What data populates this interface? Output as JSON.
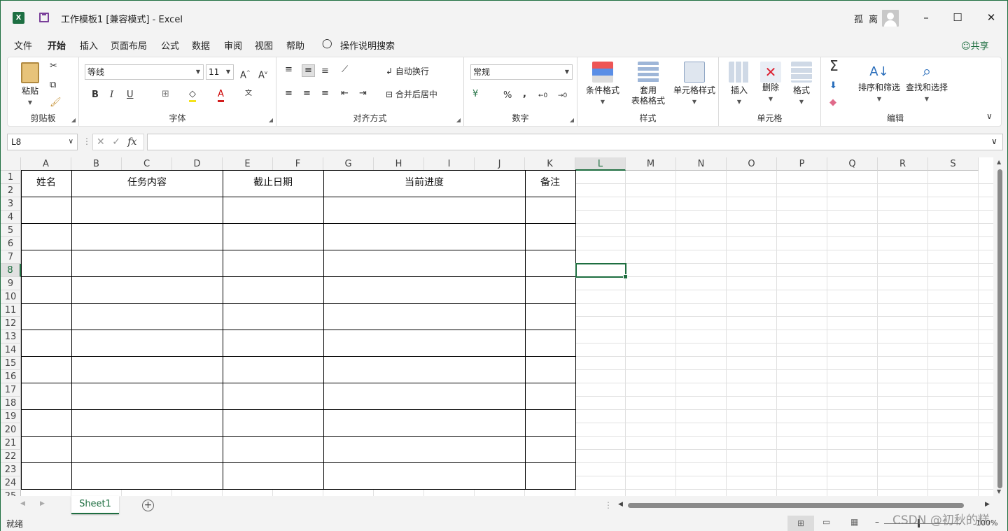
{
  "title_bar": {
    "title": "工作模板1  [兼容模式]  -  Excel",
    "username": "孤 离",
    "minimize": "–",
    "maximize": "☐",
    "close": "✕"
  },
  "menu": {
    "tabs": [
      "文件",
      "开始",
      "插入",
      "页面布局",
      "公式",
      "数据",
      "审阅",
      "视图",
      "帮助",
      "操作说明搜索"
    ],
    "active_tab": "开始",
    "share": "共享"
  },
  "ribbon": {
    "clipboard": {
      "label": "剪贴板",
      "paste": "粘贴"
    },
    "font": {
      "label": "字体",
      "font_name": "等线",
      "font_size": "11"
    },
    "alignment": {
      "label": "对齐方式",
      "wrap": "自动换行",
      "merge": "合并后居中"
    },
    "number": {
      "label": "数字",
      "format": "常规",
      "percent": "%",
      "comma": ","
    },
    "styles": {
      "label": "样式",
      "conditional": "条件格式",
      "table_1": "套用",
      "table_2": "表格格式",
      "cell_styles": "单元格样式"
    },
    "cells": {
      "label": "单元格",
      "insert": "插入",
      "delete": "删除",
      "format": "格式"
    },
    "editing": {
      "label": "编辑",
      "sort_filter": "排序和筛选",
      "find_select": "查找和选择"
    }
  },
  "formula_bar": {
    "name_box": "L8",
    "fx": "fx",
    "formula": ""
  },
  "grid": {
    "columns": [
      "A",
      "B",
      "C",
      "D",
      "E",
      "F",
      "G",
      "H",
      "I",
      "J",
      "K",
      "L",
      "M",
      "N",
      "O",
      "P",
      "Q",
      "R",
      "S"
    ],
    "rows": [
      "1",
      "2",
      "3",
      "4",
      "5",
      "6",
      "7",
      "8",
      "9",
      "10",
      "11",
      "12",
      "13",
      "14",
      "15",
      "16",
      "17",
      "18",
      "19",
      "20",
      "21",
      "22",
      "23",
      "24",
      "25"
    ],
    "selected_cell": "L8",
    "table_headers": [
      "姓名",
      "任务内容",
      "截止日期",
      "当前进度",
      "备注"
    ]
  },
  "sheet_tabs": {
    "active": "Sheet1",
    "add": "+"
  },
  "status_bar": {
    "status": "就绪",
    "zoom": "100%"
  },
  "watermark": "CSDN @初秋的糕",
  "colors": {
    "accent": "#1e6e40",
    "excel_green": "#1d6f42",
    "save_purple": "#7a3f9a"
  }
}
